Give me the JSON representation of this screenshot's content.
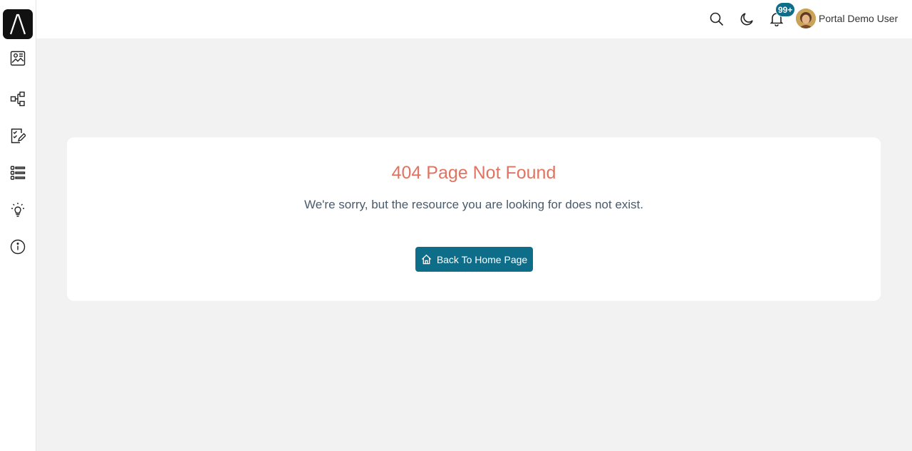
{
  "sidebar": {
    "logo_icon": "logo-lambda-icon",
    "items": [
      {
        "name": "dashboard",
        "icon": "chart-image-icon"
      },
      {
        "name": "hierarchy",
        "icon": "hierarchy-icon"
      },
      {
        "name": "edit-checklist",
        "icon": "edit-checklist-icon"
      },
      {
        "name": "list",
        "icon": "list-icon"
      },
      {
        "name": "ideas",
        "icon": "lightbulb-icon"
      },
      {
        "name": "info",
        "icon": "info-icon"
      }
    ]
  },
  "header": {
    "notification_count": "99+",
    "user_name": "Portal Demo User"
  },
  "main": {
    "title": "404 Page Not Found",
    "message": "We're sorry, but the resource you are looking for does not exist.",
    "button_label": "Back To Home Page"
  },
  "colors": {
    "accent": "#0e6e8a",
    "error_title": "#e07462",
    "background": "#f2f2f2"
  }
}
